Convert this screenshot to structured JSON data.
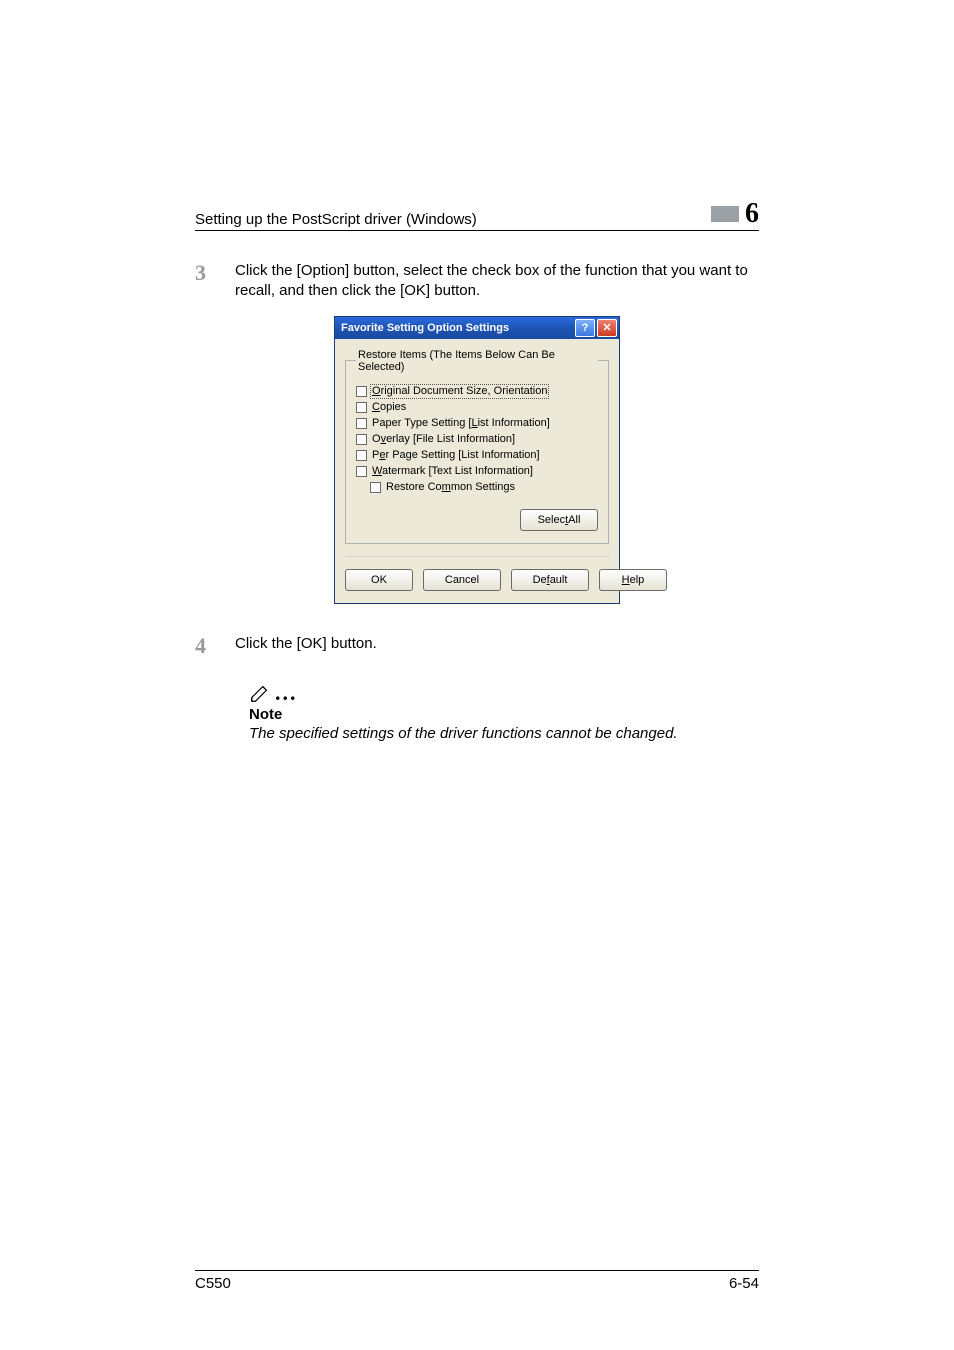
{
  "header": {
    "title": "Setting up the PostScript driver (Windows)",
    "chapter": "6"
  },
  "steps": {
    "s3": {
      "num": "3",
      "text": "Click the [Option] button, select the check box of the function that you want to recall, and then click the [OK] button."
    },
    "s4": {
      "num": "4",
      "text": "Click the [OK] button."
    }
  },
  "dialog": {
    "title": "Favorite Setting Option Settings",
    "help_glyph": "?",
    "close_glyph": "✕",
    "group_legend": "Restore Items (The Items Below Can Be Selected)",
    "items": {
      "original": {
        "pre": "",
        "u": "O",
        "post": "riginal Document Size, Orientation",
        "checked": false,
        "focused": true
      },
      "copies": {
        "pre": "",
        "u": "C",
        "post": "opies",
        "checked": false
      },
      "paper_type": {
        "pre": "Paper Type Setting [",
        "u": "L",
        "post": "ist Information]",
        "checked": false
      },
      "overlay": {
        "pre": "O",
        "u": "v",
        "post": "erlay [File List Information]",
        "checked": false
      },
      "per_page": {
        "pre": "P",
        "u": "e",
        "post": "r Page Setting [List Information]",
        "checked": false
      },
      "watermark": {
        "pre": "",
        "u": "W",
        "post": "atermark [Text List Information]",
        "checked": false
      },
      "common": {
        "pre": "Restore Co",
        "u": "m",
        "post": "mon Settings",
        "checked": false
      }
    },
    "select_all": {
      "pre": "Selec",
      "u": "t",
      "post": " All"
    },
    "buttons": {
      "ok": "OK",
      "cancel": "Cancel",
      "default": {
        "pre": "De",
        "u": "f",
        "post": "ault"
      },
      "help": {
        "pre": "",
        "u": "H",
        "post": "elp"
      }
    }
  },
  "note": {
    "dots": "...",
    "label": "Note",
    "text": "The specified settings of the driver functions cannot be changed."
  },
  "footer": {
    "left": "C550",
    "right": "6-54"
  }
}
